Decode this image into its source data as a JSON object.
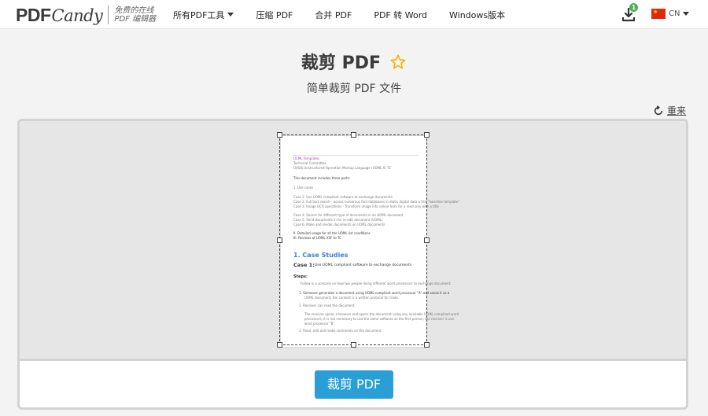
{
  "header": {
    "logo": {
      "main": "PDF",
      "script": "Candy",
      "tagline_line1": "免费的在线",
      "tagline_line2": "PDF 编辑器"
    },
    "nav": [
      {
        "label": "所有PDF工具",
        "has_dropdown": true
      },
      {
        "label": "压缩 PDF"
      },
      {
        "label": "合并 PDF"
      },
      {
        "label": "PDF 转 Word"
      },
      {
        "label": "Windows版本"
      }
    ],
    "downloads_badge": "1",
    "language": {
      "label": "CN",
      "flag": "china-flag"
    }
  },
  "page": {
    "title": "裁剪 PDF",
    "subtitle": "简单裁剪 PDF 文件",
    "reset_label": "重来",
    "crop_button_label": "裁剪 PDF"
  },
  "document_preview": {
    "lines": [
      "UCML Templates",
      "Technical Committee",
      "OASIS Unstructured Operation Markup Language (UOML-X) TC",
      "This document includes three parts:",
      "1.    Use cases",
      "Case 1: Use UOML compliant software to exchange documents",
      "Case 2: Full text search - across numerous font databases in static digital data a first \"baseline template\"",
      "Case 3: Image OCR operations - Transform image into online form for a read only with a title",
      "Case 4: Search for different type of documents in an UOML document",
      "Case 5: Send documents in for re-edit document (UOML)",
      "Case 6: Make and render documents on UOML documents",
      "II.    Detailed usage for all the UOML list conditions",
      "III.   Reviews of UOML XSF to TC",
      "1. Case Studies",
      "Case 1:",
      "Use UOML compliant software to exchange documents",
      "Steps:",
      "Follow is a scenario on how two people doing different word processors to exchange document:",
      "1.    Someone generates a document using UOML-compliant word processor \"A\" and saves it as a",
      "UOML document; the content is a written protocol for trade.",
      "2.    Receiver can read the document.",
      "The receiver opens a browser and opens the document using any available UOML-compliant word",
      "processors; it is not necessary to use the same software as the first person; the receiver is use",
      "word processor \"B\".",
      "3.    Read, edit and make comments on the document."
    ]
  }
}
